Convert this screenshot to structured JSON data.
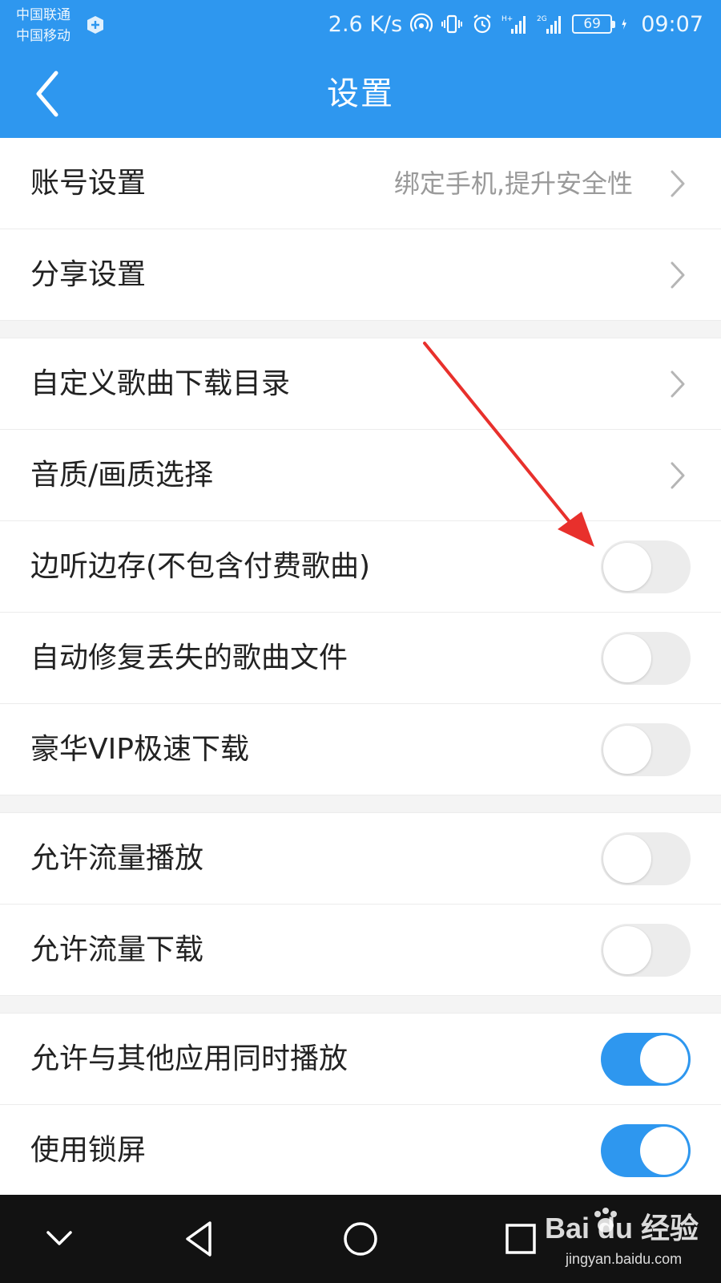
{
  "status_bar": {
    "carrier_1": "中国联通",
    "carrier_2": "中国移动",
    "speed": "2.6 K/s",
    "net_1": "H+",
    "net_2": "2G",
    "battery": "69",
    "time": "09:07"
  },
  "header": {
    "title": "设置",
    "back_icon": "chevron-left-icon"
  },
  "groups": [
    {
      "rows": [
        {
          "label": "账号设置",
          "hint": "绑定手机,提升安全性",
          "control": "chevron"
        },
        {
          "label": "分享设置",
          "control": "chevron"
        }
      ]
    },
    {
      "rows": [
        {
          "label": "自定义歌曲下载目录",
          "control": "chevron"
        },
        {
          "label": "音质/画质选择",
          "control": "chevron"
        },
        {
          "label": "边听边存(不包含付费歌曲)",
          "control": "toggle",
          "on": false
        },
        {
          "label": "自动修复丢失的歌曲文件",
          "control": "toggle",
          "on": false
        },
        {
          "label": "豪华VIP极速下载",
          "control": "toggle",
          "on": false
        }
      ]
    },
    {
      "rows": [
        {
          "label": "允许流量播放",
          "control": "toggle",
          "on": false
        },
        {
          "label": "允许流量下载",
          "control": "toggle",
          "on": false
        }
      ]
    },
    {
      "rows": [
        {
          "label": "允许与其他应用同时播放",
          "control": "toggle",
          "on": true
        },
        {
          "label": "使用锁屏",
          "control": "toggle",
          "on": true
        }
      ]
    }
  ],
  "nav_bar": {
    "buttons": [
      "chevron-down-icon",
      "back-triangle-icon",
      "home-circle-icon",
      "recents-square-icon"
    ]
  },
  "watermark": {
    "brand": "Bai du 经验",
    "url": "jingyan.baidu.com"
  },
  "colors": {
    "accent": "#2e97ef",
    "toggle_off": "#ececec",
    "annotation_arrow": "#e8302c"
  }
}
